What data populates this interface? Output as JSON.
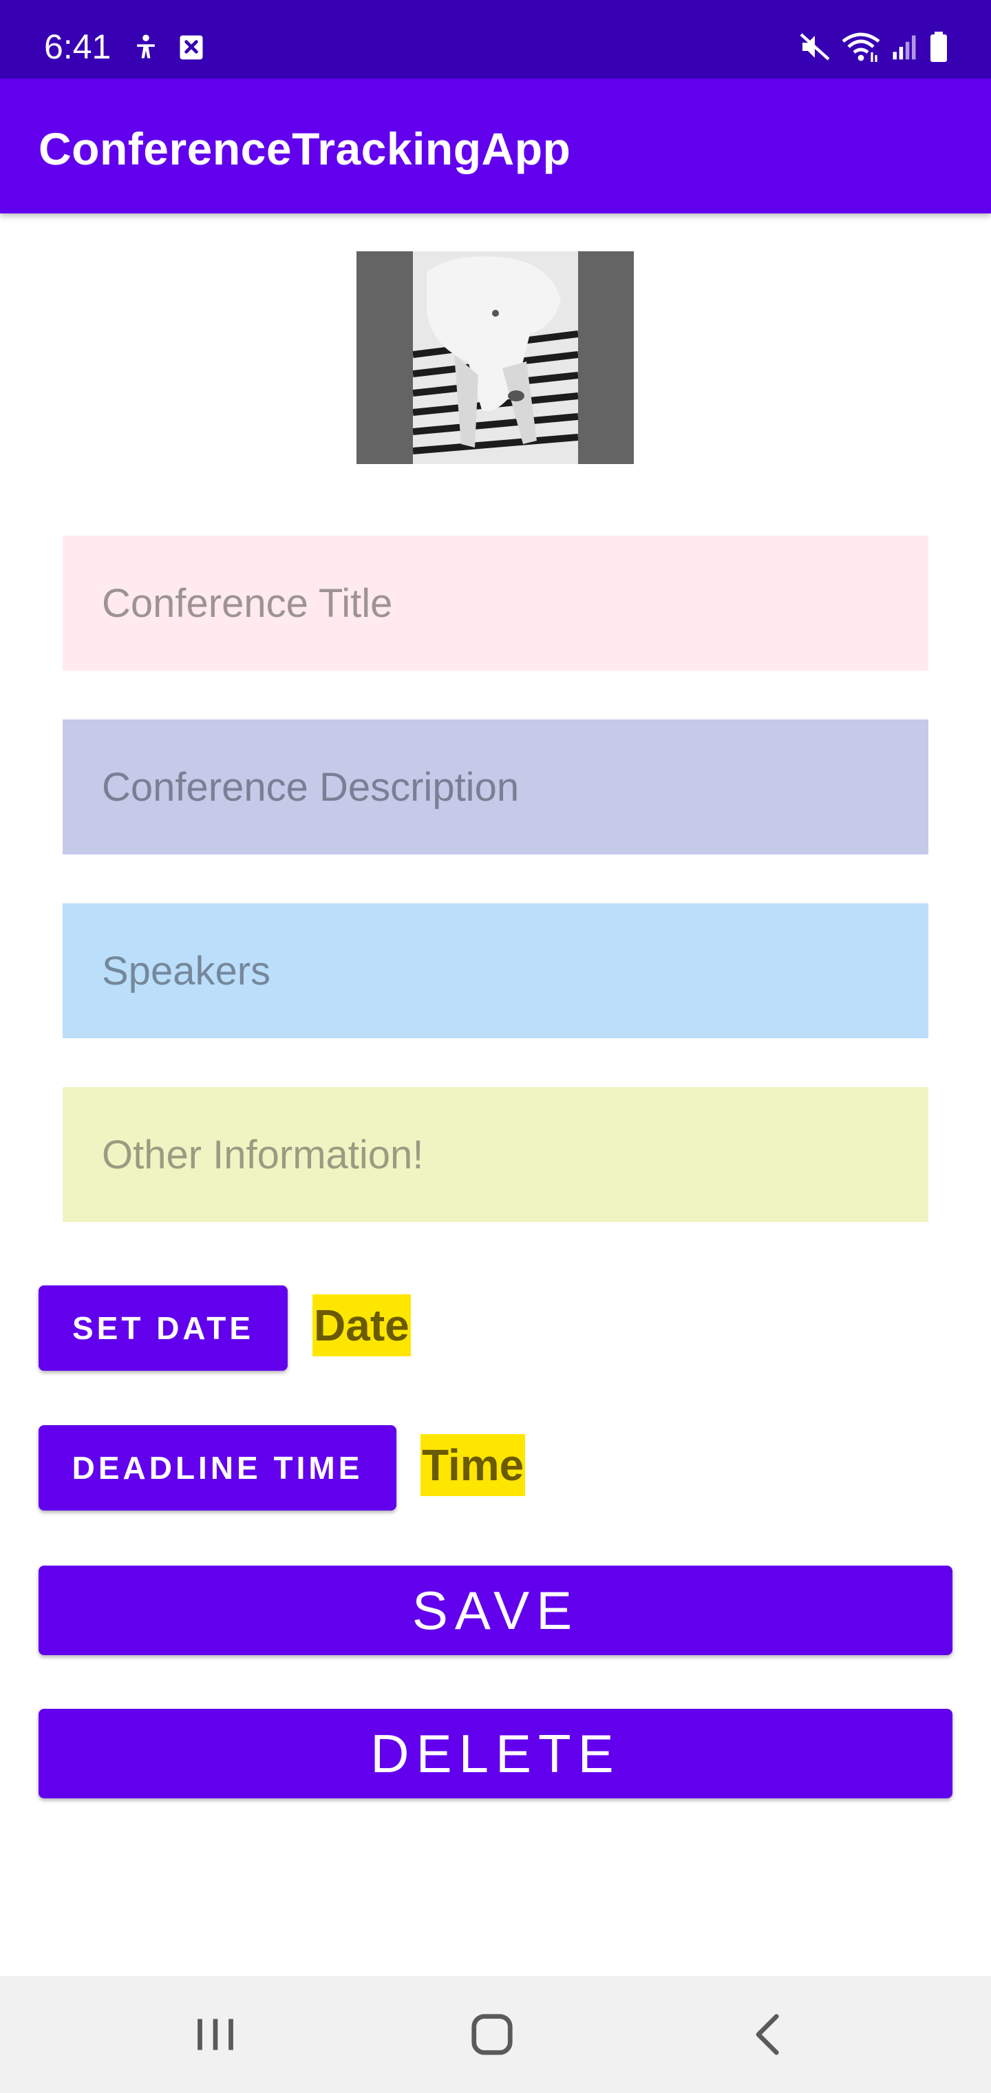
{
  "status_bar": {
    "time": "6:41",
    "left_icons": [
      "accessibility-icon",
      "close-box-icon"
    ],
    "right_icons": [
      "mute-icon",
      "wifi-icon",
      "signal-icon",
      "battery-icon"
    ]
  },
  "app_bar": {
    "title": "ConferenceTrackingApp"
  },
  "image": {
    "description_icon": "dog-photo"
  },
  "form": {
    "title_placeholder": "Conference Title",
    "description_placeholder": "Conference Description",
    "speakers_placeholder": "Speakers",
    "other_placeholder": "Other Information!"
  },
  "actions": {
    "set_date_label": "SET DATE",
    "date_value": "Date",
    "deadline_time_label": "DEADLINE TIME",
    "time_value": "Time",
    "save_label": "SAVE",
    "delete_label": "DELETE"
  },
  "nav_bar": {
    "icons": [
      "recents-icon",
      "home-icon",
      "back-icon"
    ]
  },
  "colors": {
    "status_bar": "#3700b3",
    "app_bar": "#6200ee",
    "button": "#6200ee",
    "title_field": "#ffebee",
    "description_field": "#c5cae9",
    "speakers_field": "#bbdefb",
    "other_field": "#f0f4c3",
    "tag_highlight": "#ffe600"
  }
}
